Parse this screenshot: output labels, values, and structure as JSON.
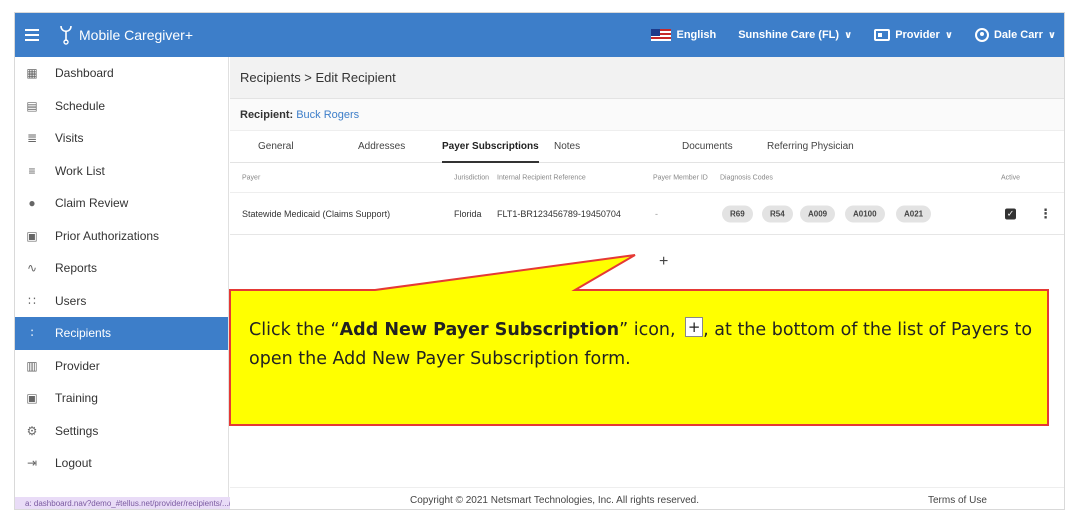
{
  "topbar": {
    "app_title": "Mobile Caregiver+",
    "language": "English",
    "agency": "Sunshine Care (FL)",
    "role": "Provider",
    "user": "Dale Carr"
  },
  "sidebar": {
    "items": [
      {
        "label": "Dashboard",
        "icon": "dashboard-icon"
      },
      {
        "label": "Schedule",
        "icon": "calendar-icon"
      },
      {
        "label": "Visits",
        "icon": "filter-icon"
      },
      {
        "label": "Work List",
        "icon": "list-icon"
      },
      {
        "label": "Claim Review",
        "icon": "alert-icon"
      },
      {
        "label": "Prior Authorizations",
        "icon": "calendar-check-icon"
      },
      {
        "label": "Reports",
        "icon": "trend-icon"
      },
      {
        "label": "Users",
        "icon": "users-icon"
      },
      {
        "label": "Recipients",
        "icon": "recipients-icon"
      },
      {
        "label": "Provider",
        "icon": "clipboard-icon"
      },
      {
        "label": "Training",
        "icon": "training-icon"
      },
      {
        "label": "Settings",
        "icon": "gear-icon"
      },
      {
        "label": "Logout",
        "icon": "logout-icon"
      }
    ],
    "active_index": 8,
    "status_url": "a: dashboard.nav?demo_#tellus.net/provider/recipients/.../addresses"
  },
  "main": {
    "breadcrumb": "Recipients > Edit Recipient",
    "recipient_label": "Recipient:",
    "recipient_name": "Buck Rogers",
    "tabs": [
      "General",
      "Addresses",
      "Payer Subscriptions",
      "Notes",
      "Documents",
      "Referring Physician"
    ],
    "active_tab": "Payer Subscriptions",
    "columns": {
      "payer": "Payer",
      "jurisdiction": "Jurisdiction",
      "internal_ref": "Internal Recipient Reference",
      "member_id": "Payer Member ID",
      "diagnosis": "Diagnosis Codes",
      "active": "Active"
    },
    "row": {
      "payer": "Statewide Medicaid (Claims Support)",
      "jurisdiction": "Florida",
      "internal_ref": "FLT1-BR123456789-19450704",
      "member_id": "-",
      "codes": [
        "R69",
        "R54",
        "A009",
        "A0100",
        "A021"
      ]
    },
    "add_symbol": "+"
  },
  "footer": {
    "copyright": "Copyright © 2021 Netsmart Technologies, Inc. All rights reserved.",
    "terms": "Terms of Use"
  },
  "callout": {
    "part1": "Click the “",
    "bold": "Add New Payer Subscription",
    "part2": "” icon,",
    "icon": "+",
    "part3": ", at the bottom of the list of Payers to open the Add New Payer Subscription form.",
    "fill": "#ffff00",
    "border": "#e53935"
  }
}
